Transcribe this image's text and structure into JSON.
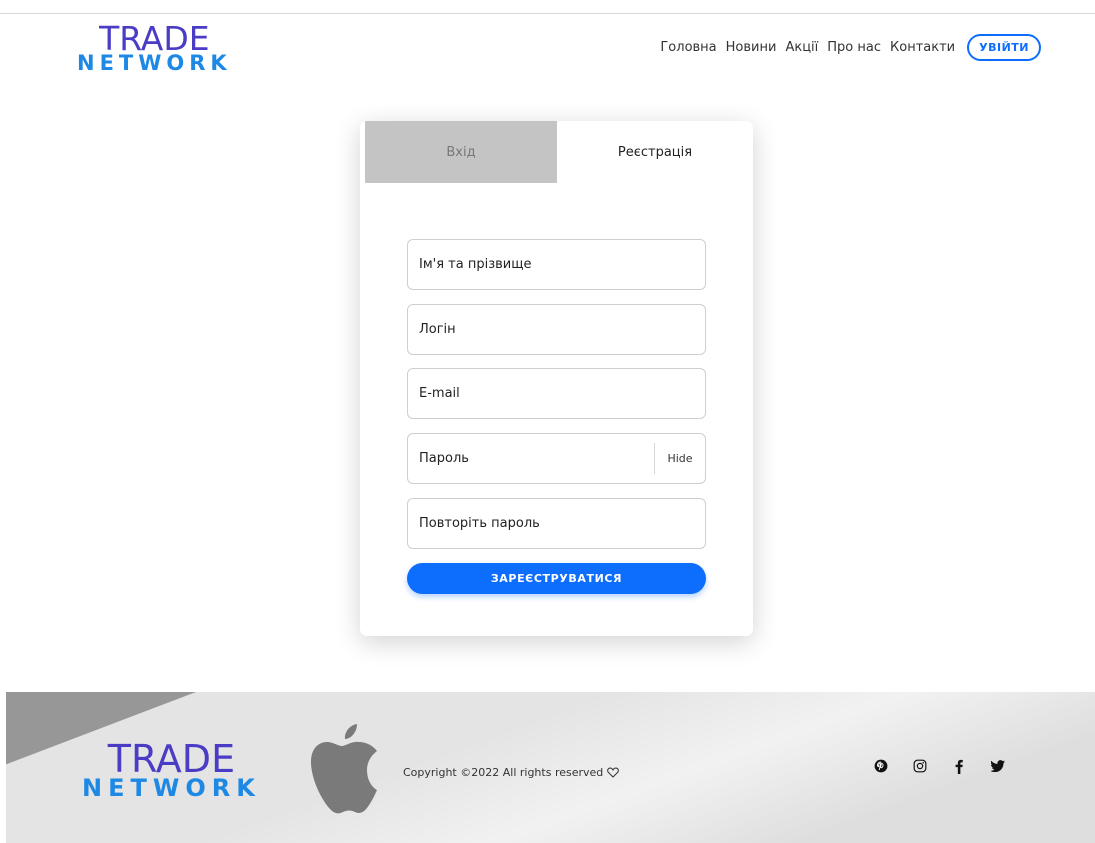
{
  "header": {
    "logo_line1": "TRADE",
    "logo_line2": "NETWORK",
    "nav": [
      "Головна",
      "Новини",
      "Акції",
      "Про нас",
      "Контакти"
    ],
    "login_label": "УВІЙТИ"
  },
  "auth": {
    "tabs": [
      "Вхід",
      "Реєстрація"
    ],
    "active_tab": "Реєстрація",
    "fields": {
      "fullname_placeholder": "Ім'я та прізвище",
      "login_placeholder": "Логін",
      "email_placeholder": "E-mail",
      "password_placeholder": "Пароль",
      "password_toggle": "Hide",
      "repeat_password_placeholder": "Повторіть пароль"
    },
    "submit_label": "ЗАРЕЄСТРУВАТИСЯ"
  },
  "footer": {
    "logo_line1": "TRADE",
    "logo_line2": "NETWORK",
    "copyright": "Copyright ©2022 All rights reserved",
    "social": [
      "pinterest-icon",
      "instagram-icon",
      "facebook-icon",
      "twitter-icon"
    ]
  },
  "colors": {
    "brand_purple": "#4b3cc6",
    "brand_blue": "#1e88e5",
    "accent": "#0d6efd"
  }
}
